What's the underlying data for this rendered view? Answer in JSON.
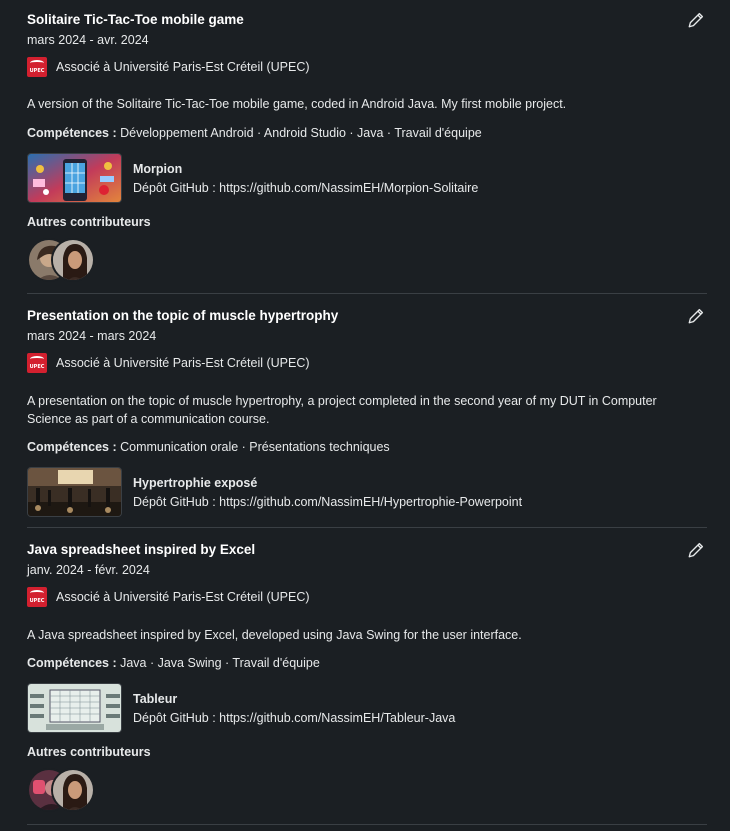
{
  "projects": [
    {
      "title": "Solitaire Tic-Tac-Toe mobile game",
      "dates": "mars 2024 - avr. 2024",
      "association": "Associé à Université Paris-Est Créteil (UPEC)",
      "logo_text": "UPEC",
      "description": "A version of the Solitaire Tic-Tac-Toe mobile game, coded in Android Java. My first mobile project.",
      "skills_label": "Compétences :",
      "skills": "Développement Android · Android Studio · Java · Travail d'équipe",
      "media": {
        "title": "Morpion",
        "description": "Dépôt GitHub : https://github.com/NassimEH/Morpion-Solitaire"
      },
      "contributors_label": "Autres contributeurs"
    },
    {
      "title": "Presentation on the topic of muscle hypertrophy",
      "dates": "mars 2024 - mars 2024",
      "association": "Associé à Université Paris-Est Créteil (UPEC)",
      "logo_text": "UPEC",
      "description": "A presentation on the topic of muscle hypertrophy, a project completed in the second year of my DUT in Computer Science as part of a communication course.",
      "skills_label": "Compétences :",
      "skills": "Communication orale · Présentations techniques",
      "media": {
        "title": "Hypertrophie exposé",
        "description": "Dépôt GitHub : https://github.com/NassimEH/Hypertrophie-Powerpoint"
      }
    },
    {
      "title": "Java spreadsheet inspired by Excel",
      "dates": "janv. 2024 - févr. 2024",
      "association": "Associé à Université Paris-Est Créteil (UPEC)",
      "logo_text": "UPEC",
      "description": "A Java spreadsheet inspired by Excel, developed using Java Swing for the user interface.",
      "skills_label": "Compétences :",
      "skills": "Java · Java Swing · Travail d'équipe",
      "media": {
        "title": "Tableur",
        "description": "Dépôt GitHub : https://github.com/NassimEH/Tableur-Java"
      },
      "contributors_label": "Autres contributeurs"
    }
  ],
  "icons": {
    "edit": "pencil-icon"
  },
  "colors": {
    "background": "#1b1f23",
    "text": "#e7e9ea",
    "divider": "#3a3f44",
    "upec_red": "#d3202f"
  }
}
